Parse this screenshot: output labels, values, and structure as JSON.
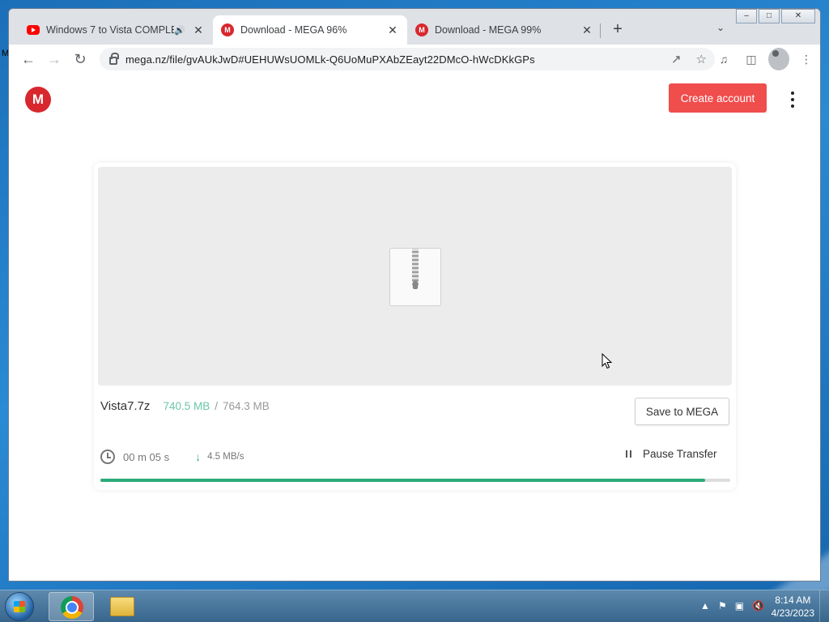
{
  "browser": {
    "tabs": [
      {
        "title": "Windows 7 to Vista COMPLE",
        "favicon": "youtube-icon",
        "audio": true,
        "active": false
      },
      {
        "title": "Download - MEGA 96%",
        "favicon": "mega-icon",
        "active": true
      },
      {
        "title": "Download - MEGA 99%",
        "favicon": "mega-icon",
        "active": false
      }
    ],
    "url": "mega.nz/file/gvAUkJwD#UEHUWsUOMLk-Q6UoMuPXAbZEayt22DMcO-hWcDKkGPs"
  },
  "header": {
    "logo_letter": "M",
    "create_account_label": "Create account"
  },
  "download": {
    "file_name": "Vista7.7z",
    "downloaded": "740.5 MB",
    "separator": "/",
    "total": "764.3 MB",
    "save_label": "Save to MEGA",
    "eta": "00 m  05 s",
    "speed": "4.5 MB/s",
    "pause_label": "Pause Transfer",
    "progress_fraction": 0.96,
    "accent_color": "#2bab7a",
    "downloaded_color": "#6ac7a6"
  },
  "taskbar": {
    "time": "8:14 AM",
    "date": "4/23/2023"
  },
  "colors": {
    "mega_red": "#d9272e",
    "create_button": "#f04d4d"
  }
}
